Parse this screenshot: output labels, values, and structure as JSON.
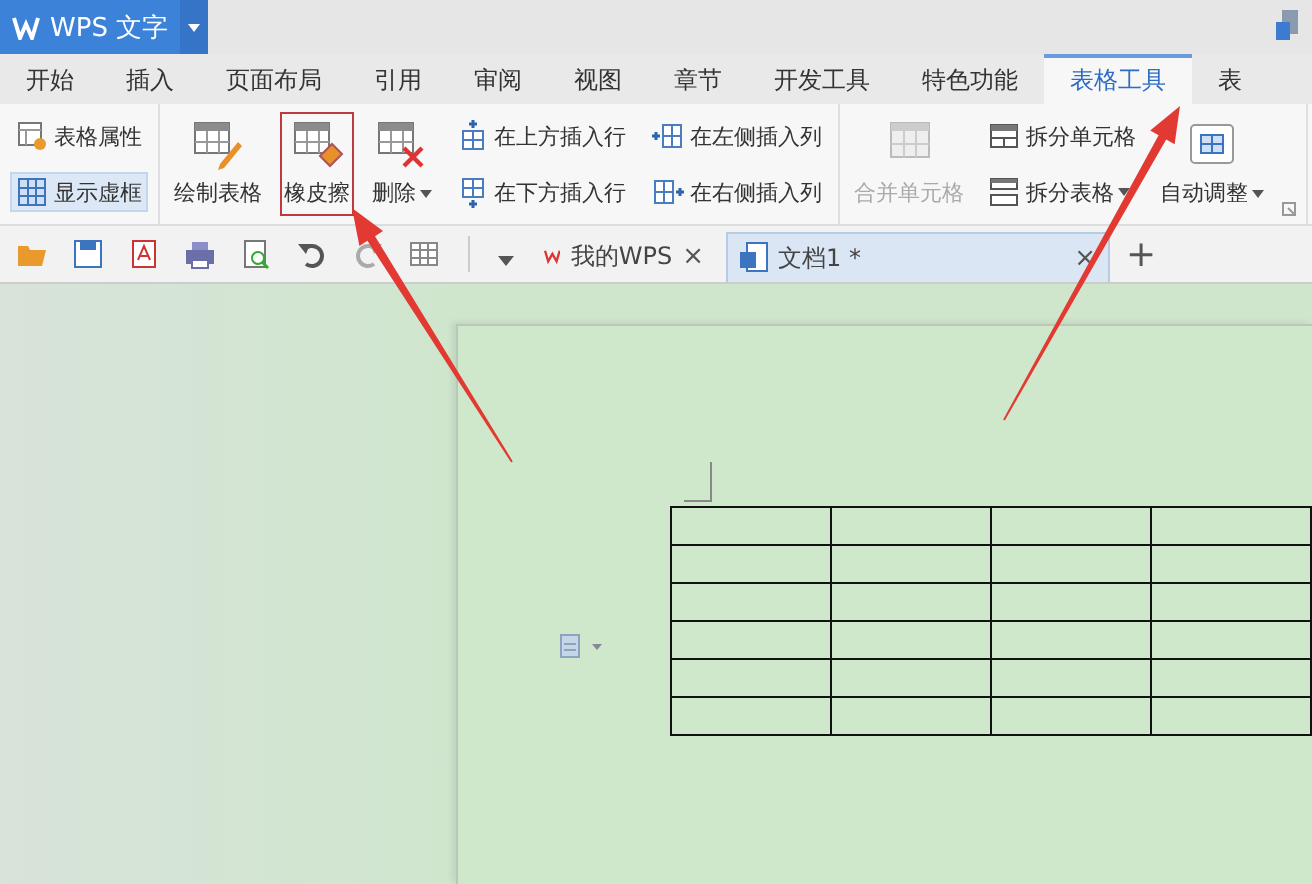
{
  "window": {
    "app_button": {
      "label": "WPS 文字"
    }
  },
  "menu_tabs": [
    {
      "label": "开始",
      "selected": false
    },
    {
      "label": "插入",
      "selected": false
    },
    {
      "label": "页面布局",
      "selected": false
    },
    {
      "label": "引用",
      "selected": false
    },
    {
      "label": "审阅",
      "selected": false
    },
    {
      "label": "视图",
      "selected": false
    },
    {
      "label": "章节",
      "selected": false
    },
    {
      "label": "开发工具",
      "selected": false
    },
    {
      "label": "特色功能",
      "selected": false
    },
    {
      "label": "表格工具",
      "selected": true
    },
    {
      "label": "表",
      "selected": false
    }
  ],
  "ribbon": {
    "groups": [
      {
        "launcher": false,
        "columns": [
          {
            "items": [
              {
                "kind": "small",
                "label": "表格属性",
                "dropdown": false,
                "disabled": false,
                "on": false,
                "marked": false
              },
              {
                "kind": "small",
                "label": "显示虚框",
                "dropdown": false,
                "disabled": false,
                "on": true,
                "marked": false
              }
            ]
          }
        ]
      },
      {
        "launcher": false,
        "columns": [
          {
            "items": [
              {
                "kind": "large",
                "label": "绘制表格",
                "dropdown": false,
                "disabled": false,
                "on": false,
                "marked": false
              }
            ]
          },
          {
            "items": [
              {
                "kind": "large",
                "label": "橡皮擦",
                "dropdown": false,
                "disabled": false,
                "on": false,
                "marked": true
              }
            ]
          },
          {
            "items": [
              {
                "kind": "large",
                "label": "删除",
                "dropdown": true,
                "disabled": false,
                "on": false,
                "marked": false
              }
            ]
          },
          {
            "items": [
              {
                "kind": "small",
                "label": "在上方插入行",
                "dropdown": false,
                "disabled": false,
                "on": false,
                "marked": false
              },
              {
                "kind": "small",
                "label": "在下方插入行",
                "dropdown": false,
                "disabled": false,
                "on": false,
                "marked": false
              }
            ]
          },
          {
            "items": [
              {
                "kind": "small",
                "label": "在左侧插入列",
                "dropdown": false,
                "disabled": false,
                "on": false,
                "marked": false
              },
              {
                "kind": "small",
                "label": "在右侧插入列",
                "dropdown": false,
                "disabled": false,
                "on": false,
                "marked": false
              }
            ]
          }
        ]
      },
      {
        "launcher": true,
        "columns": [
          {
            "items": [
              {
                "kind": "large",
                "label": "合并单元格",
                "dropdown": false,
                "disabled": true,
                "on": false,
                "marked": false
              }
            ]
          },
          {
            "items": [
              {
                "kind": "small",
                "label": "拆分单元格",
                "dropdown": false,
                "disabled": false,
                "on": false,
                "marked": false
              },
              {
                "kind": "small",
                "label": "拆分表格",
                "dropdown": true,
                "disabled": false,
                "on": false,
                "marked": false
              }
            ]
          },
          {
            "items": [
              {
                "kind": "large",
                "label": "自动调整",
                "dropdown": true,
                "disabled": false,
                "on": false,
                "marked": false
              }
            ]
          }
        ]
      }
    ]
  },
  "doc_tabs": [
    {
      "label": "我的WPS",
      "close": "×",
      "selected": false
    },
    {
      "label": "文档1 *",
      "close": "×",
      "selected": true
    }
  ],
  "new_tab": "+",
  "table": {
    "rows": [
      {
        "cells": [
          {
            "selected": false
          },
          {
            "selected": false
          },
          {
            "selected": false
          },
          {
            "selected": false
          }
        ]
      },
      {
        "cells": [
          {
            "selected": false
          },
          {
            "selected": false
          },
          {
            "selected": false
          },
          {
            "selected": false
          }
        ]
      },
      {
        "cells": [
          {
            "selected": false
          },
          {
            "selected": false
          },
          {
            "selected": false
          },
          {
            "selected": false
          }
        ]
      },
      {
        "cells": [
          {
            "selected": false
          },
          {
            "selected": false
          },
          {
            "selected": false
          },
          {
            "selected": false
          }
        ]
      },
      {
        "cells": [
          {
            "selected": false
          },
          {
            "selected": false
          },
          {
            "selected": false
          },
          {
            "selected": false
          }
        ]
      },
      {
        "cells": [
          {
            "selected": false
          },
          {
            "selected": false
          },
          {
            "selected": false
          },
          {
            "selected": false
          }
        ]
      }
    ]
  }
}
